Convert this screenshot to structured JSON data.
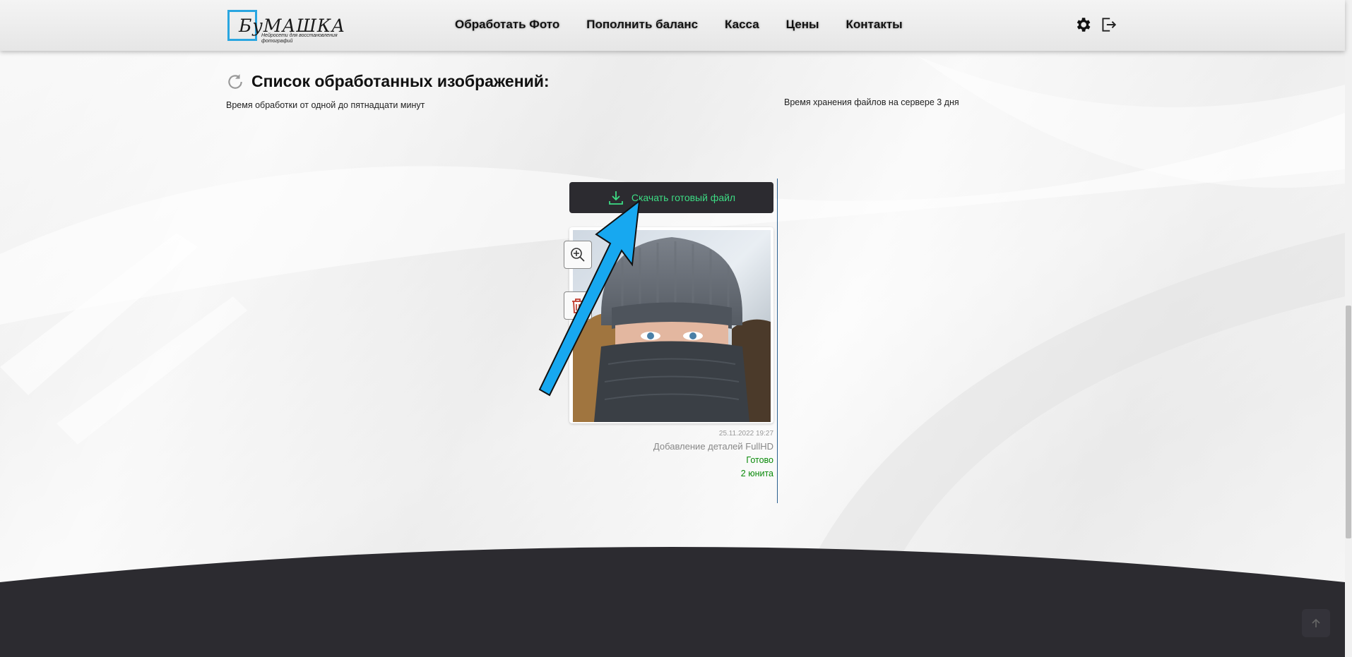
{
  "brand": {
    "logo_text": "БуМАШКА",
    "logo_subtitle": "Нейросети для восстановления фотографий",
    "accent_color": "#2aa6e0"
  },
  "nav": {
    "items": [
      {
        "label": "Обработать Фото"
      },
      {
        "label": "Пополнить баланс"
      },
      {
        "label": "Касса"
      },
      {
        "label": "Цены"
      },
      {
        "label": "Контакты"
      }
    ]
  },
  "header_icons": [
    "gear-icon",
    "logout-icon"
  ],
  "page": {
    "title": "Список обработанных изображений:",
    "processing_time_note": "Время обработки от одной до пятнадцати минут",
    "storage_note": "Время хранения файлов на сервере 3 дня"
  },
  "card": {
    "download_label": "Скачать готовый файл",
    "date": "25.11.2022 19:27",
    "type": "Добавление деталей FullHD",
    "status": "Готово",
    "units": "2 юнита",
    "status_color": "#0a8a0a",
    "download_text_color": "#3ddc84"
  },
  "colors": {
    "footer": "#2c2b30",
    "arrow": "#17a8f0"
  }
}
